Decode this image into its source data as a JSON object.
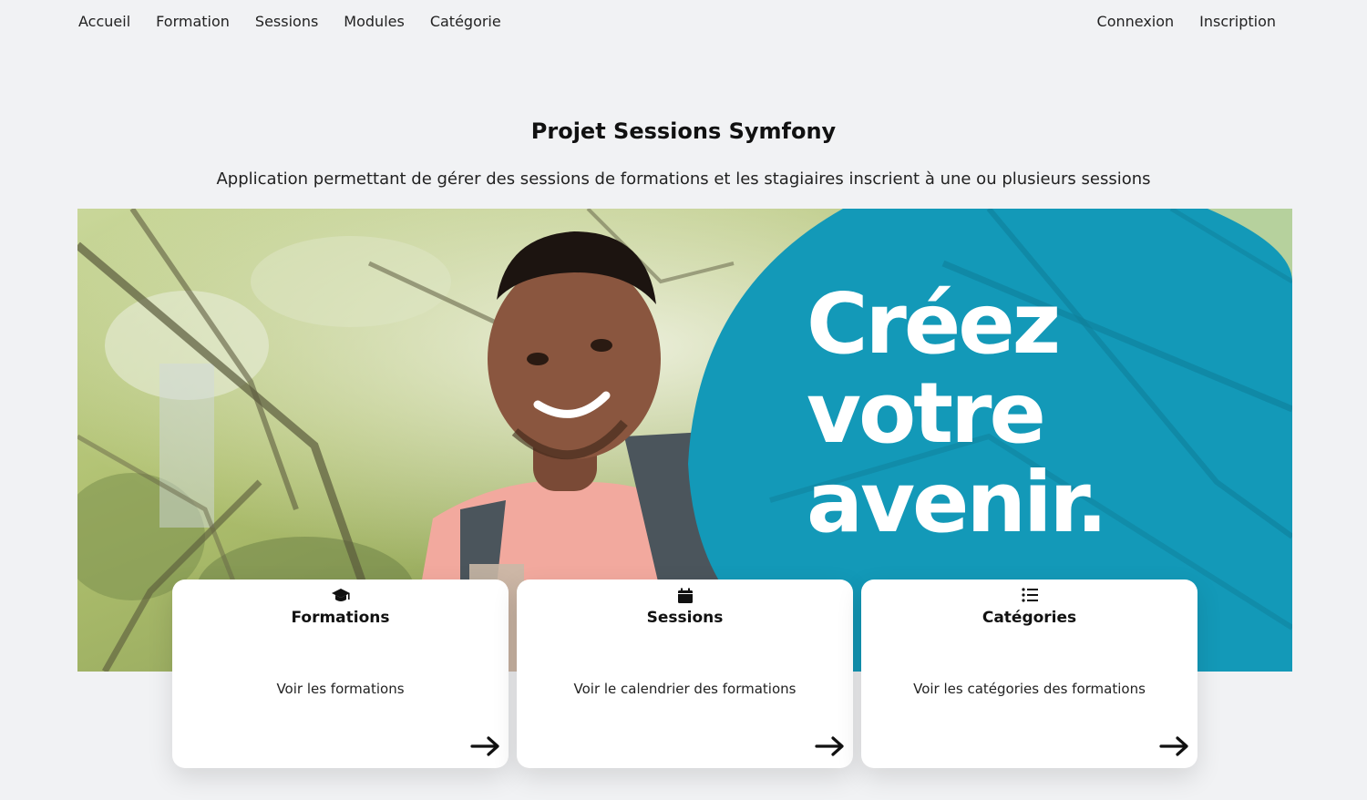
{
  "nav": {
    "left": [
      "Accueil",
      "Formation",
      "Sessions",
      "Modules",
      "Catégorie"
    ],
    "right": [
      "Connexion",
      "Inscription"
    ]
  },
  "hero": {
    "title": "Projet Sessions Symfony",
    "subtitle": "Application permettant de gérer des sessions de formations et les stagiaires inscrient à une ou plusieurs sessions"
  },
  "banner": {
    "lines": [
      "Créez",
      "votre",
      "avenir."
    ],
    "accent_color": "#1399b8"
  },
  "cards": [
    {
      "title": "Formations",
      "description": "Voir les formations",
      "icon": "graduation-cap-icon"
    },
    {
      "title": "Sessions",
      "description": "Voir le calendrier des formations",
      "icon": "calendar-icon"
    },
    {
      "title": "Catégories",
      "description": "Voir les catégories des formations",
      "icon": "list-icon"
    }
  ]
}
